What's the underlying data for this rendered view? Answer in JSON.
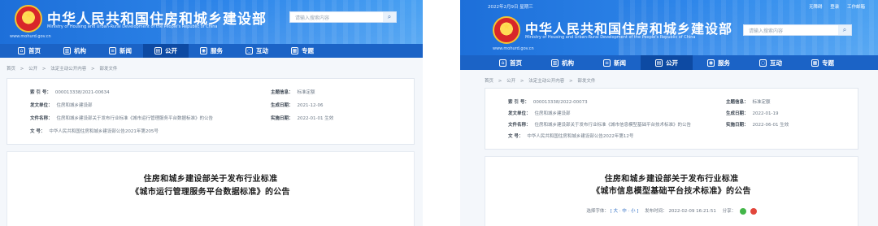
{
  "left": {
    "site_title": "中华人民共和国住房和城乡建设部",
    "site_subtitle": "Ministry of Housing and Urban-Rural Development of the People's Republic of China",
    "site_url": "www.mohurd.gov.cn",
    "search_placeholder": "请输入搜索内容",
    "nav": [
      {
        "label": "首页",
        "icon": "home-icon"
      },
      {
        "label": "机构",
        "icon": "institution-icon"
      },
      {
        "label": "新闻",
        "icon": "news-icon"
      },
      {
        "label": "公开",
        "icon": "open-info-icon",
        "active": true
      },
      {
        "label": "服务",
        "icon": "service-icon"
      },
      {
        "label": "互动",
        "icon": "interaction-icon"
      },
      {
        "label": "专题",
        "icon": "topic-icon"
      }
    ],
    "breadcrumb": [
      "首页",
      ">",
      "公开",
      ">",
      "法定主动公开内容",
      ">",
      "部发文件"
    ],
    "info": {
      "index_key": "索 引 号：",
      "index_val": "000013338/2021-00634",
      "category_key": "主题信息：",
      "category_val": "标准定额",
      "issuer_key": "发文单位：",
      "issuer_val": "住房和城乡建设部",
      "date_key": "生成日期：",
      "date_val": "2021-12-06",
      "docname_key": "文件名称：",
      "docname_val": "住房和城乡建设部关于发布行业标准《城市运行管理服务平台数据标准》的公告",
      "effective_key": "实施日期：",
      "effective_val": "2022-01-01 生效",
      "docno_key": "文 号：",
      "docno_val": "中华人民共和国住房和城乡建设部公告2021年第205号"
    },
    "article": {
      "title_line1": "住房和城乡建设部关于发布行业标准",
      "title_line2": "《城市运行管理服务平台数据标准》的公告"
    }
  },
  "right": {
    "date_text": "2022年2月9日 星期三",
    "tools": [
      "无障碍",
      "登录",
      "工作邮箱"
    ],
    "site_title": "中华人民共和国住房和城乡建设部",
    "site_subtitle": "Ministry of Housing and Urban-Rural Development of the People's Republic of China",
    "site_url": "www.mohurd.gov.cn",
    "search_placeholder": "请输入搜索内容",
    "nav": [
      {
        "label": "首页",
        "icon": "home-icon"
      },
      {
        "label": "机构",
        "icon": "institution-icon"
      },
      {
        "label": "新闻",
        "icon": "news-icon"
      },
      {
        "label": "公开",
        "icon": "open-info-icon",
        "active": true
      },
      {
        "label": "服务",
        "icon": "service-icon"
      },
      {
        "label": "互动",
        "icon": "interaction-icon"
      },
      {
        "label": "专题",
        "icon": "topic-icon"
      }
    ],
    "breadcrumb": [
      "首页",
      ">",
      "公开",
      ">",
      "法定主动公开内容",
      ">",
      "部发文件"
    ],
    "info": {
      "index_key": "索 引 号：",
      "index_val": "000013338/2022-00073",
      "category_key": "主题信息：",
      "category_val": "标准定额",
      "issuer_key": "发文单位：",
      "issuer_val": "住房和城乡建设部",
      "date_key": "生成日期：",
      "date_val": "2022-01-19",
      "docname_key": "文件名称：",
      "docname_val": "住房和城乡建设部关于发布行业标准《城市信息模型基础平台技术标准》的公告",
      "effective_key": "实施日期：",
      "effective_val": "2022-06-01 生效",
      "docno_key": "文 号：",
      "docno_val": "中华人民共和国住房和城乡建设部公告2022年第12号"
    },
    "article": {
      "title_line1": "住房和城乡建设部关于发布行业标准",
      "title_line2": "《城市信息模型基础平台技术标准》的公告",
      "font_label": "选择字体：",
      "font_sizes": "[ 大 · 中 · 小 ]",
      "publish_label": "发布时间：",
      "publish_time": "2022-02-09 16:21:51",
      "share_label": "分享："
    }
  },
  "colors": {
    "header_blue": "#2e86ea",
    "nav_blue": "#1b63c6",
    "nav_active": "#0d4aa3"
  }
}
